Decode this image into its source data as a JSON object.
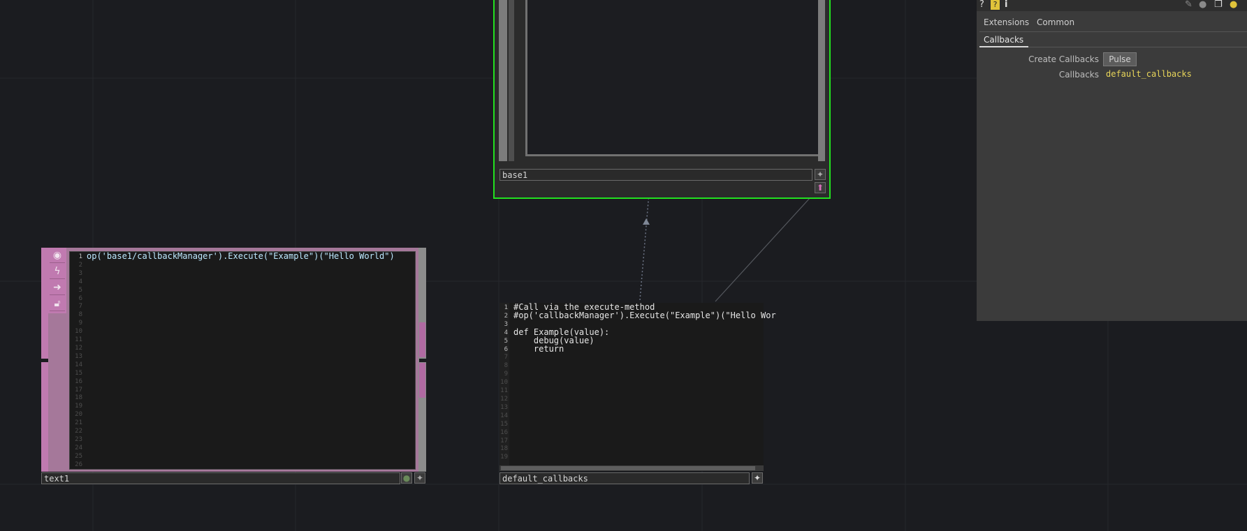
{
  "colors": {
    "selected_border": "#22e11f",
    "text_dat": "#c07ab0",
    "param_value": "#e8d55a"
  },
  "base1": {
    "name": "base1"
  },
  "text1": {
    "name": "text1",
    "toolbar_icons": [
      "viewer-toggle-icon",
      "lightning-icon",
      "arrow-right-icon",
      "lock-icon"
    ],
    "line_numbers": [
      "1",
      "2",
      "3",
      "4",
      "5",
      "6",
      "7",
      "8",
      "9",
      "10",
      "11",
      "12",
      "13",
      "14",
      "15",
      "16",
      "17",
      "18",
      "19",
      "20",
      "21",
      "22",
      "23",
      "24",
      "25",
      "26"
    ],
    "code": "op('base1/callbackManager').Execute(\"Example\")(\"Hello World\")"
  },
  "default_callbacks": {
    "name": "default_callbacks",
    "line_numbers": [
      "1",
      "2",
      "3",
      "4",
      "5",
      "6",
      "7",
      "8",
      "9",
      "10",
      "11",
      "12",
      "13",
      "14",
      "15",
      "16",
      "17",
      "18",
      "19"
    ],
    "code": "#Call via the execute-method\n#op('callbackManager').Execute(\"Example\")(\"Hello Wor\n\ndef Example(value):\n    debug(value)\n    return"
  },
  "params": {
    "top_icons_left": [
      "help-icon",
      "python-help-icon",
      "info-icon"
    ],
    "top_icons_right": [
      "edit-icon",
      "comment-icon",
      "clone-icon",
      "python-icon"
    ],
    "tabs": [
      "Extensions",
      "Common"
    ],
    "active_page": "Callbacks",
    "rows": [
      {
        "label": "Create Callbacks",
        "button": "Pulse"
      },
      {
        "label": "Callbacks",
        "value": "default_callbacks"
      }
    ]
  }
}
